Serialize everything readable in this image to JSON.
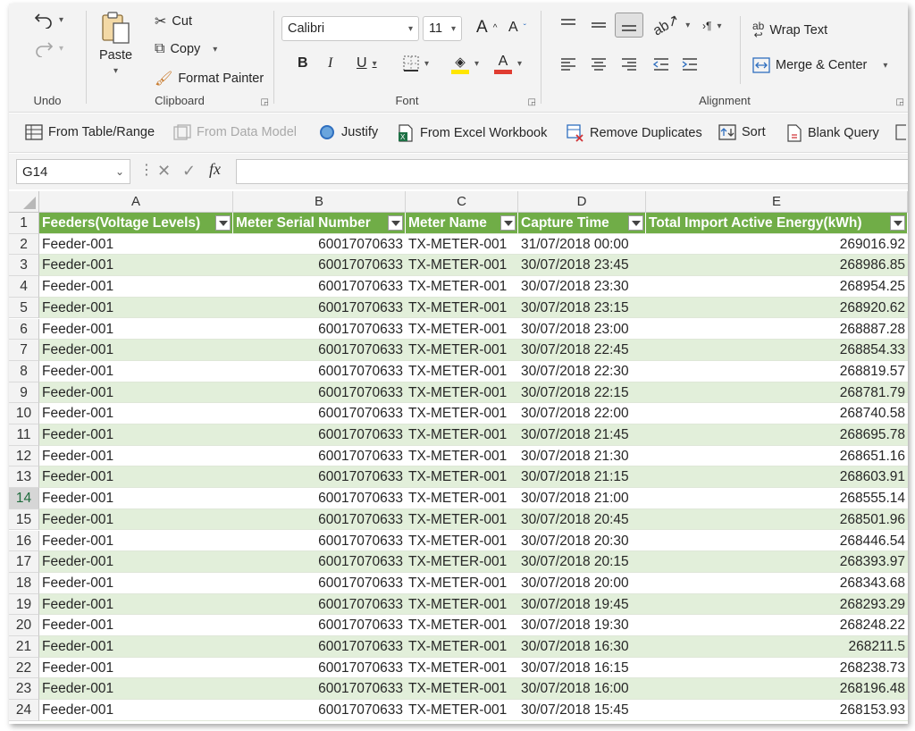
{
  "ribbon": {
    "undo_label": "Undo",
    "clipboard": {
      "paste": "Paste",
      "cut": "Cut",
      "copy": "Copy",
      "format_painter": "Format Painter",
      "label": "Clipboard"
    },
    "font": {
      "name": "Calibri",
      "size": "11",
      "label": "Font",
      "bold": "B",
      "italic": "I",
      "underline": "U",
      "grow": "A",
      "shrink": "A",
      "font_color": "A"
    },
    "alignment": {
      "wrap_text": "Wrap Text",
      "merge_center": "Merge & Center",
      "label": "Alignment",
      "ab_glyph": "ab"
    }
  },
  "query_bar": {
    "from_table": "From Table/Range",
    "from_data_model": "From Data Model",
    "justify": "Justify",
    "from_workbook": "From Excel Workbook",
    "remove_duplicates": "Remove Duplicates",
    "sort": "Sort",
    "blank_query": "Blank Query"
  },
  "formula_bar": {
    "name_box": "G14",
    "fx": "fx",
    "value": ""
  },
  "grid": {
    "columns": [
      "A",
      "B",
      "C",
      "D",
      "E"
    ],
    "headers": [
      "Feeders(Voltage Levels)",
      "Meter Serial Number",
      "Meter Name",
      "Capture Time",
      "Total Import Active Energy(kWh)"
    ],
    "rows": [
      {
        "n": "1"
      },
      {
        "n": "2",
        "a": "Feeder-001",
        "b": "60017070633",
        "c": "TX-METER-001",
        "d": "31/07/2018 00:00",
        "e": "269016.92"
      },
      {
        "n": "3",
        "a": "Feeder-001",
        "b": "60017070633",
        "c": "TX-METER-001",
        "d": "30/07/2018 23:45",
        "e": "268986.85"
      },
      {
        "n": "4",
        "a": "Feeder-001",
        "b": "60017070633",
        "c": "TX-METER-001",
        "d": "30/07/2018 23:30",
        "e": "268954.25"
      },
      {
        "n": "5",
        "a": "Feeder-001",
        "b": "60017070633",
        "c": "TX-METER-001",
        "d": "30/07/2018 23:15",
        "e": "268920.62"
      },
      {
        "n": "6",
        "a": "Feeder-001",
        "b": "60017070633",
        "c": "TX-METER-001",
        "d": "30/07/2018 23:00",
        "e": "268887.28"
      },
      {
        "n": "7",
        "a": "Feeder-001",
        "b": "60017070633",
        "c": "TX-METER-001",
        "d": "30/07/2018 22:45",
        "e": "268854.33"
      },
      {
        "n": "8",
        "a": "Feeder-001",
        "b": "60017070633",
        "c": "TX-METER-001",
        "d": "30/07/2018 22:30",
        "e": "268819.57"
      },
      {
        "n": "9",
        "a": "Feeder-001",
        "b": "60017070633",
        "c": "TX-METER-001",
        "d": "30/07/2018 22:15",
        "e": "268781.79"
      },
      {
        "n": "10",
        "a": "Feeder-001",
        "b": "60017070633",
        "c": "TX-METER-001",
        "d": "30/07/2018 22:00",
        "e": "268740.58"
      },
      {
        "n": "11",
        "a": "Feeder-001",
        "b": "60017070633",
        "c": "TX-METER-001",
        "d": "30/07/2018 21:45",
        "e": "268695.78"
      },
      {
        "n": "12",
        "a": "Feeder-001",
        "b": "60017070633",
        "c": "TX-METER-001",
        "d": "30/07/2018 21:30",
        "e": "268651.16"
      },
      {
        "n": "13",
        "a": "Feeder-001",
        "b": "60017070633",
        "c": "TX-METER-001",
        "d": "30/07/2018 21:15",
        "e": "268603.91"
      },
      {
        "n": "14",
        "a": "Feeder-001",
        "b": "60017070633",
        "c": "TX-METER-001",
        "d": "30/07/2018 21:00",
        "e": "268555.14"
      },
      {
        "n": "15",
        "a": "Feeder-001",
        "b": "60017070633",
        "c": "TX-METER-001",
        "d": "30/07/2018 20:45",
        "e": "268501.96"
      },
      {
        "n": "16",
        "a": "Feeder-001",
        "b": "60017070633",
        "c": "TX-METER-001",
        "d": "30/07/2018 20:30",
        "e": "268446.54"
      },
      {
        "n": "17",
        "a": "Feeder-001",
        "b": "60017070633",
        "c": "TX-METER-001",
        "d": "30/07/2018 20:15",
        "e": "268393.97"
      },
      {
        "n": "18",
        "a": "Feeder-001",
        "b": "60017070633",
        "c": "TX-METER-001",
        "d": "30/07/2018 20:00",
        "e": "268343.68"
      },
      {
        "n": "19",
        "a": "Feeder-001",
        "b": "60017070633",
        "c": "TX-METER-001",
        "d": "30/07/2018 19:45",
        "e": "268293.29"
      },
      {
        "n": "20",
        "a": "Feeder-001",
        "b": "60017070633",
        "c": "TX-METER-001",
        "d": "30/07/2018 19:30",
        "e": "268248.22"
      },
      {
        "n": "21",
        "a": "Feeder-001",
        "b": "60017070633",
        "c": "TX-METER-001",
        "d": "30/07/2018 16:30",
        "e": "268211.5"
      },
      {
        "n": "22",
        "a": "Feeder-001",
        "b": "60017070633",
        "c": "TX-METER-001",
        "d": "30/07/2018 16:15",
        "e": "268238.73"
      },
      {
        "n": "23",
        "a": "Feeder-001",
        "b": "60017070633",
        "c": "TX-METER-001",
        "d": "30/07/2018 16:00",
        "e": "268196.48"
      },
      {
        "n": "24",
        "a": "Feeder-001",
        "b": "60017070633",
        "c": "TX-METER-001",
        "d": "30/07/2018 15:45",
        "e": "268153.93"
      }
    ]
  },
  "colors": {
    "table_header": "#70ad47",
    "band": "#e2efda",
    "font_color_bar": "#e03c31",
    "highlight_bar": "#ffe600"
  }
}
